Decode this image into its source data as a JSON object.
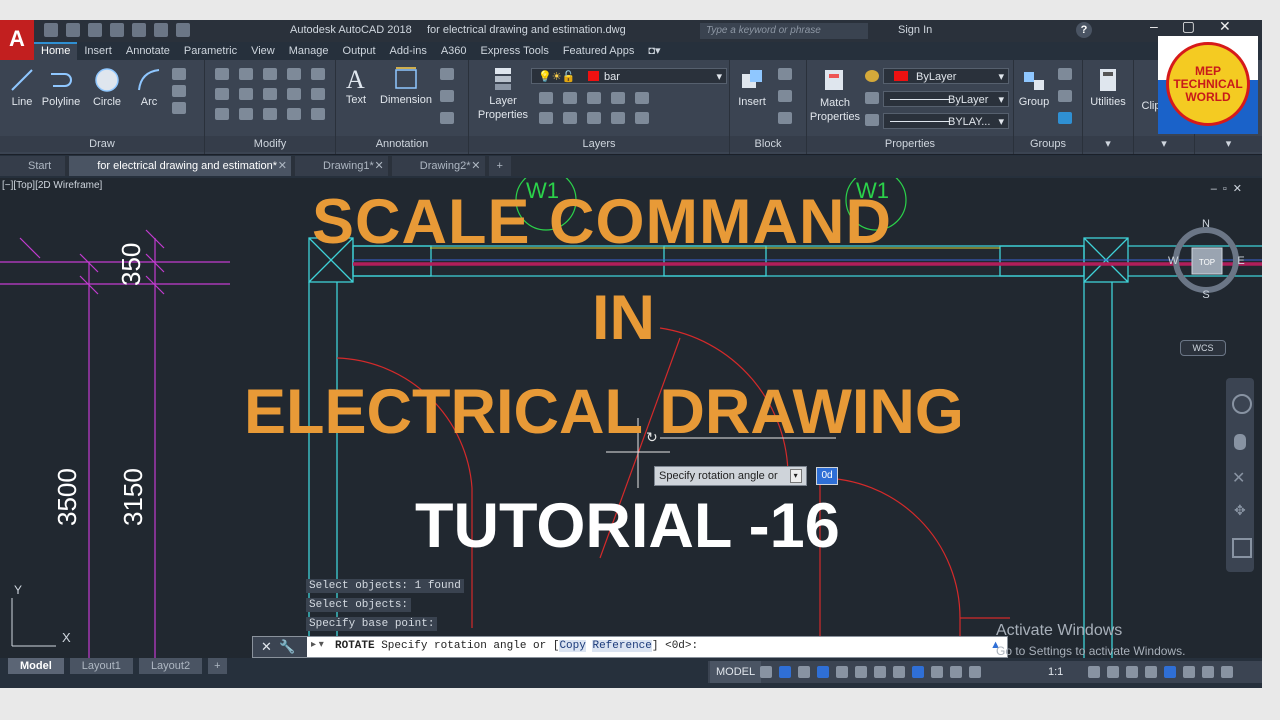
{
  "app": {
    "logo_letter": "A",
    "title": "Autodesk AutoCAD 2018     for electrical drawing and estimation.dwg",
    "search_placeholder": "Type a keyword or phrase",
    "sign_in": "Sign In",
    "help": "?"
  },
  "ribbon": {
    "tabs": [
      "Home",
      "Insert",
      "Annotate",
      "Parametric",
      "View",
      "Manage",
      "Output",
      "Add-ins",
      "A360",
      "Express Tools",
      "Featured Apps"
    ],
    "active_tab": "Home",
    "draw": {
      "title": "Draw",
      "line": "Line",
      "polyline": "Polyline",
      "circle": "Circle",
      "arc": "Arc"
    },
    "modify": {
      "title": "Modify"
    },
    "annotation": {
      "title": "Annotation",
      "text": "Text",
      "dimension": "Dimension"
    },
    "layers": {
      "title": "Layers",
      "layer_properties_1": "Layer",
      "layer_properties_2": "Properties",
      "current_layer": "bar"
    },
    "block": {
      "title": "Block",
      "insert": "Insert"
    },
    "properties": {
      "title": "Properties",
      "match_1": "Match",
      "match_2": "Properties",
      "color": "ByLayer",
      "linetype": "ByLayer",
      "lineweight": "BYLAY..."
    },
    "groups": {
      "title": "Groups",
      "group": "Group"
    },
    "utilities": "Utilities",
    "clipboard": "Clip"
  },
  "file_tabs": [
    {
      "label": "Start",
      "active": false
    },
    {
      "label": "for electrical drawing and estimation*",
      "active": true
    },
    {
      "label": "Drawing1*",
      "active": false
    },
    {
      "label": "Drawing2*",
      "active": false
    }
  ],
  "viewport": {
    "label": "[−][Top][2D Wireframe]",
    "dims": {
      "d350": "350",
      "d3500": "3500",
      "d3150": "3150"
    },
    "tags": {
      "w1": "W1"
    },
    "compass": {
      "n": "N",
      "s": "S",
      "e": "E",
      "w": "W",
      "top": "TOP"
    },
    "wcs": "WCS",
    "axis": {
      "y": "Y",
      "x": "X"
    }
  },
  "overlay": {
    "line1": "SCALE  COMMAND",
    "line2": "IN",
    "line3": "ELECTRICAL DRAWING",
    "line4": "TUTORIAL -16"
  },
  "tooltip": {
    "prompt": "Specify rotation angle or",
    "value": "0d"
  },
  "command": {
    "history": [
      "Select objects: 1 found",
      "Select objects:",
      "Specify base point:"
    ],
    "prefix": "ROTATE",
    "prompt": " Specify rotation angle or [",
    "opt_copy": "Copy",
    "opt_ref": "Reference",
    "suffix": "] <0d>:"
  },
  "layout_tabs": [
    "Model",
    "Layout1",
    "Layout2"
  ],
  "status": {
    "model": "MODEL",
    "scale": "1:1"
  },
  "watermark": {
    "line1": "Activate Windows",
    "line2": "Go to Settings to activate Windows."
  },
  "brand": {
    "line1": "MEP",
    "line2": "TECHNICAL",
    "line3": "WORLD"
  }
}
